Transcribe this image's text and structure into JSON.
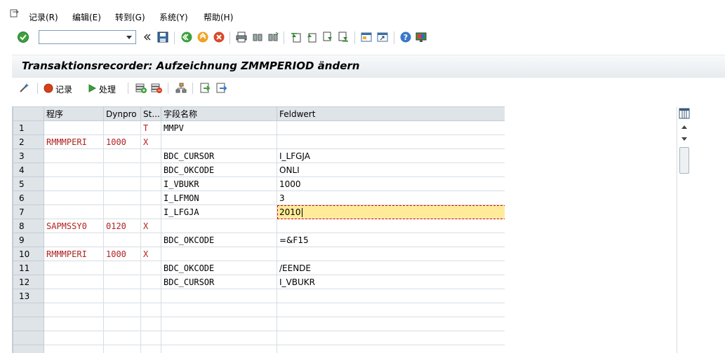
{
  "menu": {
    "items": [
      {
        "label": "记录(R)"
      },
      {
        "label": "编辑(E)"
      },
      {
        "label": "转到(G)"
      },
      {
        "label": "系统(Y)"
      },
      {
        "label": "帮助(H)"
      }
    ]
  },
  "toolbar": {
    "command_value": "",
    "icons": [
      "enter-icon",
      "command-dropdown-icon",
      "collapse-icon",
      "save-icon",
      "back-icon",
      "exit-icon",
      "cancel-icon",
      "print-icon",
      "find-icon",
      "find-next-icon",
      "first-page-icon",
      "prev-page-icon",
      "next-page-icon",
      "last-page-icon",
      "new-session-icon",
      "shortcut-icon",
      "help-icon",
      "customize-layout-icon"
    ]
  },
  "title": "Transaktionsrecorder: Aufzeichnung ZMMPERIOD ändern",
  "app_toolbar": {
    "record_label": "记录",
    "process_label": "处理"
  },
  "grid": {
    "columns": [
      "程序",
      "Dynpro",
      "St...",
      "字段名称",
      "Feldwert"
    ],
    "rows": [
      {
        "n": "1",
        "prog": "",
        "dynpro": "",
        "st": "T",
        "field": "MMPV",
        "value": ""
      },
      {
        "n": "2",
        "prog": "RMMMPERI",
        "dynpro": "1000",
        "st": "X",
        "field": "",
        "value": ""
      },
      {
        "n": "3",
        "prog": "",
        "dynpro": "",
        "st": "",
        "field": "BDC_CURSOR",
        "value": "I_LFGJA"
      },
      {
        "n": "4",
        "prog": "",
        "dynpro": "",
        "st": "",
        "field": "BDC_OKCODE",
        "value": "ONLI"
      },
      {
        "n": "5",
        "prog": "",
        "dynpro": "",
        "st": "",
        "field": "I_VBUKR",
        "value": "1000"
      },
      {
        "n": "6",
        "prog": "",
        "dynpro": "",
        "st": "",
        "field": "I_LFMON",
        "value": "3"
      },
      {
        "n": "7",
        "prog": "",
        "dynpro": "",
        "st": "",
        "field": "I_LFGJA",
        "value": "2010"
      },
      {
        "n": "8",
        "prog": "SAPMSSY0",
        "dynpro": "0120",
        "st": "X",
        "field": "",
        "value": ""
      },
      {
        "n": "9",
        "prog": "",
        "dynpro": "",
        "st": "",
        "field": "BDC_OKCODE",
        "value": "=&F15"
      },
      {
        "n": "10",
        "prog": "RMMMPERI",
        "dynpro": "1000",
        "st": "X",
        "field": "",
        "value": ""
      },
      {
        "n": "11",
        "prog": "",
        "dynpro": "",
        "st": "",
        "field": "BDC_OKCODE",
        "value": "/EENDE"
      },
      {
        "n": "12",
        "prog": "",
        "dynpro": "",
        "st": "",
        "field": "BDC_CURSOR",
        "value": "I_VBUKR"
      },
      {
        "n": "13",
        "prog": "",
        "dynpro": "",
        "st": "",
        "field": "",
        "value": ""
      },
      {
        "n": "",
        "prog": "",
        "dynpro": "",
        "st": "",
        "field": "",
        "value": ""
      },
      {
        "n": "",
        "prog": "",
        "dynpro": "",
        "st": "",
        "field": "",
        "value": ""
      },
      {
        "n": "",
        "prog": "",
        "dynpro": "",
        "st": "",
        "field": "",
        "value": ""
      },
      {
        "n": "",
        "prog": "",
        "dynpro": "",
        "st": "",
        "field": "",
        "value": ""
      }
    ]
  },
  "colors": {
    "red_text": "#b22222",
    "highlight": "#ffeb99",
    "header_bg": "#dfe4e9"
  }
}
